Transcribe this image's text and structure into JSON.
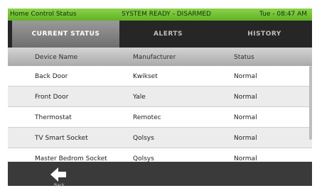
{
  "header": {
    "title": "Home Control Status",
    "system_status": "SYSTEM READY - DISARMED",
    "datetime": "Tue - 08:47 AM"
  },
  "tabs": [
    {
      "label": "CURRENT STATUS",
      "active": true
    },
    {
      "label": "ALERTS",
      "active": false
    },
    {
      "label": "HISTORY",
      "active": false
    }
  ],
  "table": {
    "columns": [
      "Device Name",
      "Manufacturer",
      "Status"
    ],
    "rows": [
      {
        "device": "Back Door",
        "manufacturer": "Kwikset",
        "status": "Normal"
      },
      {
        "device": "Front Door",
        "manufacturer": "Yale",
        "status": "Normal"
      },
      {
        "device": "Thermostat",
        "manufacturer": "Remotec",
        "status": "Normal"
      },
      {
        "device": "TV Smart Socket",
        "manufacturer": "Qolsys",
        "status": "Normal"
      },
      {
        "device": "Master Bedrom Socket",
        "manufacturer": "Qolsys",
        "status": "Normal"
      }
    ]
  },
  "footer": {
    "back_label": "Back",
    "back_icon": "arrow-left-icon"
  },
  "colors": {
    "header_green": "#6dbb2d",
    "tab_bar": "#262626",
    "footer": "#3a3a3a"
  }
}
